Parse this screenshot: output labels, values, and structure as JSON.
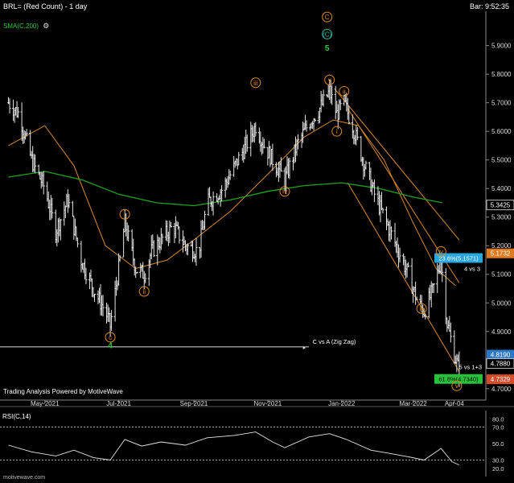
{
  "header": {
    "title": "BRL= (Red Count) - 1 day",
    "bar_time": "Bar: 9:52:35",
    "sma_label": "SMA(C,200)",
    "footer_credit": "Trading Analysis Powered by MotiveWave",
    "rsi_label": "RSI(C,14)",
    "site": "motivewave.com"
  },
  "colors": {
    "background": "#000000",
    "price_bars": "#e6e6e6",
    "sma200": "#1fa31f",
    "sma_short": "#d98a2a",
    "channel": "#d98a2a",
    "wave_orange": "#e08a1e",
    "wave_green": "#2ecc40",
    "wave_teal": "#2ab5a5",
    "fib_upper_bg": "#2aa6e0",
    "fib_lower_bg": "#27c23c",
    "last_price_bg": "#d64b2a",
    "prev_price_bg": "#2a78c8",
    "level_5173_bg": "#e07a1e"
  },
  "chart_data": {
    "type": "ohlc",
    "symbol": "BRL=",
    "interval": "1 day",
    "x_ticks": [
      "May-2021",
      "Jul-2021",
      "Sep-2021",
      "Nov-2021",
      "Jan-2022",
      "Mar-2022",
      "Apr-04"
    ],
    "y_ticks": [
      "4.7000",
      "4.8000",
      "4.9000",
      "5.0000",
      "5.1000",
      "5.2000",
      "5.3000",
      "5.4000",
      "5.5000",
      "5.6000",
      "5.7000",
      "5.8000",
      "5.9000"
    ],
    "ylim": [
      4.66,
      6.02
    ],
    "price_path": [
      [
        "2021-04-01",
        5.7
      ],
      [
        "2021-04-10",
        5.66
      ],
      [
        "2021-04-20",
        5.5
      ],
      [
        "2021-05-01",
        5.4
      ],
      [
        "2021-05-10",
        5.25
      ],
      [
        "2021-05-20",
        5.36
      ],
      [
        "2021-05-31",
        5.15
      ],
      [
        "2021-06-10",
        5.05
      ],
      [
        "2021-06-20",
        4.97
      ],
      [
        "2021-06-24",
        4.92
      ],
      [
        "2021-07-02",
        5.15
      ],
      [
        "2021-07-06",
        5.28
      ],
      [
        "2021-07-15",
        5.12
      ],
      [
        "2021-07-22",
        5.1
      ],
      [
        "2021-07-28",
        5.18
      ],
      [
        "2021-08-05",
        5.22
      ],
      [
        "2021-08-15",
        5.27
      ],
      [
        "2021-08-25",
        5.2
      ],
      [
        "2021-09-05",
        5.18
      ],
      [
        "2021-09-12",
        5.35
      ],
      [
        "2021-09-25",
        5.4
      ],
      [
        "2021-10-05",
        5.48
      ],
      [
        "2021-10-14",
        5.55
      ],
      [
        "2021-10-22",
        5.62
      ],
      [
        "2021-10-29",
        5.55
      ],
      [
        "2021-11-05",
        5.5
      ],
      [
        "2021-11-15",
        5.43
      ],
      [
        "2021-11-25",
        5.55
      ],
      [
        "2021-12-05",
        5.63
      ],
      [
        "2021-12-14",
        5.68
      ],
      [
        "2021-12-22",
        5.74
      ],
      [
        "2021-12-28",
        5.66
      ],
      [
        "2022-01-03",
        5.7
      ],
      [
        "2022-01-10",
        5.62
      ],
      [
        "2022-01-20",
        5.48
      ],
      [
        "2022-01-28",
        5.38
      ],
      [
        "2022-02-05",
        5.3
      ],
      [
        "2022-02-15",
        5.2
      ],
      [
        "2022-02-25",
        5.1
      ],
      [
        "2022-03-05",
        5.0
      ],
      [
        "2022-03-10",
        4.97
      ],
      [
        "2022-03-17",
        5.04
      ],
      [
        "2022-03-24",
        5.15
      ],
      [
        "2022-03-29",
        4.93
      ],
      [
        "2022-04-04",
        4.82
      ],
      [
        "2022-04-08",
        4.76
      ]
    ],
    "sma200_path": [
      [
        "2021-04-01",
        5.44
      ],
      [
        "2021-05-01",
        5.46
      ],
      [
        "2021-06-01",
        5.43
      ],
      [
        "2021-07-01",
        5.38
      ],
      [
        "2021-08-01",
        5.35
      ],
      [
        "2021-09-01",
        5.34
      ],
      [
        "2021-10-01",
        5.36
      ],
      [
        "2021-11-01",
        5.39
      ],
      [
        "2021-12-01",
        5.41
      ],
      [
        "2022-01-01",
        5.42
      ],
      [
        "2022-02-01",
        5.4
      ],
      [
        "2022-03-01",
        5.37
      ],
      [
        "2022-03-25",
        5.35
      ]
    ],
    "sma_short_path": [
      [
        "2021-04-01",
        5.55
      ],
      [
        "2021-05-01",
        5.62
      ],
      [
        "2021-05-25",
        5.48
      ],
      [
        "2021-06-20",
        5.2
      ],
      [
        "2021-07-15",
        5.12
      ],
      [
        "2021-08-10",
        5.15
      ],
      [
        "2021-09-01",
        5.22
      ],
      [
        "2021-10-01",
        5.32
      ],
      [
        "2021-11-01",
        5.45
      ],
      [
        "2021-12-01",
        5.58
      ],
      [
        "2021-12-25",
        5.64
      ],
      [
        "2022-01-15",
        5.62
      ],
      [
        "2022-02-05",
        5.5
      ],
      [
        "2022-03-01",
        5.28
      ],
      [
        "2022-03-20",
        5.12
      ],
      [
        "2022-04-05",
        5.06
      ]
    ],
    "channel_lines": [
      [
        [
          "2021-12-26",
          5.75
        ],
        [
          "2022-04-08",
          5.22
        ]
      ],
      [
        [
          "2022-01-06",
          5.68
        ],
        [
          "2022-04-08",
          5.07
        ]
      ],
      [
        [
          "2022-01-06",
          5.42
        ],
        [
          "2022-04-08",
          4.76
        ]
      ]
    ],
    "wave_labels": [
      {
        "text": "c",
        "date": "2021-06-24",
        "price": 4.88,
        "color": "orange",
        "circle": true
      },
      {
        "text": "4",
        "date": "2021-06-24",
        "price": 4.85,
        "color": "green",
        "circle": false
      },
      {
        "text": "i",
        "date": "2021-07-06",
        "price": 5.31,
        "color": "orange",
        "circle": true
      },
      {
        "text": "ii",
        "date": "2021-07-22",
        "price": 5.04,
        "color": "orange",
        "circle": true
      },
      {
        "text": "iii",
        "date": "2021-10-22",
        "price": 5.77,
        "color": "orange",
        "circle": true
      },
      {
        "text": "iv",
        "date": "2021-11-15",
        "price": 5.39,
        "color": "orange",
        "circle": true
      },
      {
        "text": "C",
        "date": "2021-12-20",
        "price": 6.0,
        "color": "orange",
        "circle": true
      },
      {
        "text": "(C)",
        "date": "2021-12-20",
        "price": 5.94,
        "color": "teal",
        "circle": true
      },
      {
        "text": "5",
        "date": "2021-12-20",
        "price": 5.89,
        "color": "green",
        "circle": false
      },
      {
        "text": "v",
        "date": "2021-12-22",
        "price": 5.78,
        "color": "orange",
        "circle": true
      },
      {
        "text": "ii",
        "date": "2022-01-03",
        "price": 5.74,
        "color": "orange",
        "circle": true
      },
      {
        "text": "i",
        "date": "2021-12-28",
        "price": 5.6,
        "color": "orange",
        "circle": true
      },
      {
        "text": "iii",
        "date": "2022-03-08",
        "price": 4.98,
        "color": "orange",
        "circle": true
      },
      {
        "text": "iv",
        "date": "2022-03-24",
        "price": 5.18,
        "color": "orange",
        "circle": true
      },
      {
        "text": "v",
        "date": "2022-04-06",
        "price": 4.71,
        "color": "orange",
        "circle": true
      }
    ],
    "annotations": {
      "zigzag_text": "C vs A (Zig Zag)",
      "zigzag_price": 4.88,
      "fib_upper_text": "23.6%(5.1571)",
      "fib_upper_price": 5.157,
      "fib_upper_note": "4 vs 3",
      "fib_lower_text": "61.8%(4.7340)",
      "fib_lower_price": 4.734,
      "fib_lower_note": "5 vs 1+3"
    },
    "price_tags": [
      {
        "text": "5.3425",
        "price": 5.3425,
        "style": "plain"
      },
      {
        "text": "5.1732",
        "price": 5.1732,
        "style": "orange"
      },
      {
        "text": "4.8190",
        "price": 4.819,
        "style": "blue"
      },
      {
        "text": "4.7880",
        "price": 4.788,
        "style": "plain"
      },
      {
        "text": "4.7329",
        "price": 4.7329,
        "style": "red"
      }
    ],
    "rsi": {
      "ylim": [
        10,
        90
      ],
      "y_ticks": [
        "80.0",
        "70.0",
        "50.0",
        "30.0",
        "20.0"
      ],
      "reference_levels": [
        70,
        30
      ],
      "path": [
        [
          "2021-04-01",
          48
        ],
        [
          "2021-04-20",
          40
        ],
        [
          "2021-05-10",
          35
        ],
        [
          "2021-05-25",
          42
        ],
        [
          "2021-06-10",
          33
        ],
        [
          "2021-06-24",
          30
        ],
        [
          "2021-07-06",
          55
        ],
        [
          "2021-07-20",
          47
        ],
        [
          "2021-08-05",
          52
        ],
        [
          "2021-08-25",
          48
        ],
        [
          "2021-09-12",
          57
        ],
        [
          "2021-10-05",
          60
        ],
        [
          "2021-10-22",
          64
        ],
        [
          "2021-11-05",
          52
        ],
        [
          "2021-11-15",
          45
        ],
        [
          "2021-12-05",
          58
        ],
        [
          "2021-12-22",
          62
        ],
        [
          "2022-01-05",
          55
        ],
        [
          "2022-01-25",
          42
        ],
        [
          "2022-02-10",
          38
        ],
        [
          "2022-02-25",
          34
        ],
        [
          "2022-03-10",
          30
        ],
        [
          "2022-03-24",
          44
        ],
        [
          "2022-04-02",
          28
        ],
        [
          "2022-04-08",
          24
        ]
      ]
    }
  }
}
